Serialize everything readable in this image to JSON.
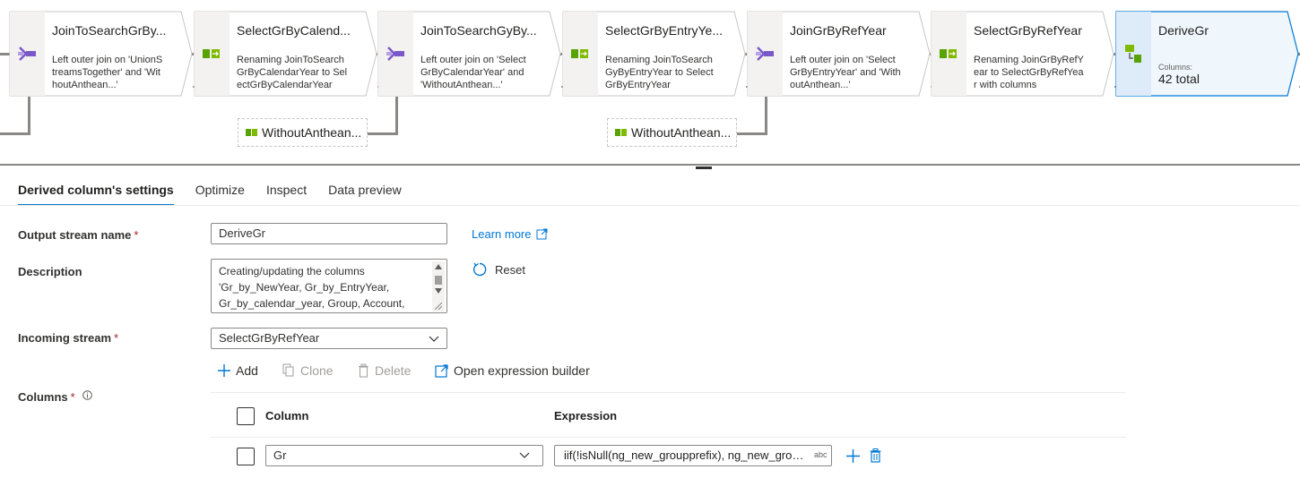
{
  "pipeline": {
    "nodes": [
      {
        "title": "JoinToSearchGrBy...",
        "description": "Left outer join on 'UnionStreamsTogether' and 'WithoutAnthean...'",
        "type": "join"
      },
      {
        "title": "SelectGrByCalend...",
        "description": "Renaming JoinToSearchGrByCalendarYear to SelectGrByCalendarYear",
        "type": "select"
      },
      {
        "title": "JoinToSearchGyBy...",
        "description": "Left outer join on 'SelectGrByCalendarYear' and 'WithoutAnthean...'",
        "type": "join"
      },
      {
        "title": "SelectGrByEntryYe...",
        "description": "Renaming JoinToSearchGyByEntryYear to SelectGrByEntryYear",
        "type": "select"
      },
      {
        "title": "JoinGrByRefYear",
        "description": "Left outer join on 'SelectGrByEntryYear' and 'WithoutAnthean...'",
        "type": "join"
      },
      {
        "title": "SelectGrByRefYear",
        "description": "Renaming JoinGrByRefYear to SelectGrByRefYear with columns",
        "type": "select"
      },
      {
        "title": "DeriveGr",
        "columns_label": "Columns:",
        "columns_value": "42 total",
        "type": "derive",
        "selected": true
      }
    ],
    "sub_nodes": [
      {
        "title": "WithoutAnthean..."
      },
      {
        "title": "WithoutAnthean..."
      }
    ]
  },
  "tabs": [
    {
      "label": "Derived column's settings",
      "active": true
    },
    {
      "label": "Optimize"
    },
    {
      "label": "Inspect"
    },
    {
      "label": "Data preview"
    }
  ],
  "form": {
    "output_stream": {
      "label": "Output stream name",
      "required": "*",
      "value": "DeriveGr"
    },
    "learn_more": "Learn more",
    "description": {
      "label": "Description",
      "value": "Creating/updating the columns 'Gr_by_NewYear, Gr_by_EntryYear, Gr_by_calendar_year, Group, Account,"
    },
    "reset": "Reset",
    "incoming_stream": {
      "label": "Incoming stream",
      "required": "*",
      "value": "SelectGrByRefYear"
    },
    "toolbar": {
      "add": "Add",
      "clone": "Clone",
      "delete": "Delete",
      "open_builder": "Open expression builder"
    },
    "columns": {
      "label": "Columns",
      "required": "*",
      "header_column": "Column",
      "header_expression": "Expression",
      "rows": [
        {
          "column": "Gr",
          "expression": "iif(!isNull(ng_new_groupprefix), ng_new_grouppr...",
          "type_badge": "abc"
        }
      ]
    }
  },
  "colors": {
    "accent": "#0078d4",
    "join_icon": "#7b58c8",
    "select_icon": "#57a300",
    "selected_fill": "#eff6fc"
  }
}
